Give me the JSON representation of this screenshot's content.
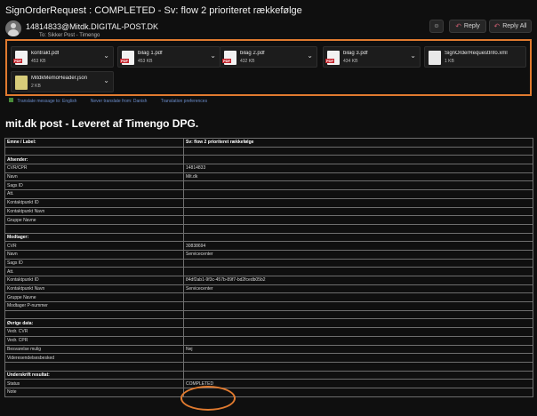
{
  "window": {
    "title": "SignOrderRequest : COMPLETED - Sv: flow 2 prioriteret rækkefølge"
  },
  "header": {
    "sender": "14814833@Mitdk.DIGITAL-POST.DK",
    "to_line": "To: Sikker Post - Timengo",
    "reply_label": "Reply",
    "reply_all_label": "Reply All",
    "emoji_icon": "smiley-icon"
  },
  "attachments": [
    {
      "name": "kontrakt.pdf",
      "size": "453 KB",
      "type": "pdf"
    },
    {
      "name": "bilag 1.pdf",
      "size": "453 KB",
      "type": "pdf"
    },
    {
      "name": "bilag 2.pdf",
      "size": "432 KB",
      "type": "pdf"
    },
    {
      "name": "bilag 3.pdf",
      "size": "434 KB",
      "type": "pdf"
    },
    {
      "name": "SignOrderRequestInfo.xml",
      "size": "1 KB",
      "type": "xml"
    },
    {
      "name": "MitdkMemoHeader.json",
      "size": "2 KB",
      "type": "json"
    }
  ],
  "notice": {
    "link1": "Translate message to: English",
    "link2": "Never translate from: Danish",
    "link3": "Translation preferences"
  },
  "body": {
    "title": "mit.dk post - Leveret af Timengo DPG.",
    "rows": [
      {
        "label": "Emne / Label:",
        "value": "Sv: flow 2 prioriteret rækkefølge",
        "bold": true
      },
      {
        "label": "",
        "value": ""
      },
      {
        "label": "Afsender:",
        "value": "",
        "bold": true
      },
      {
        "label": "CVR/CPR",
        "value": "14814833"
      },
      {
        "label": "Navn",
        "value": "Mit.dk"
      },
      {
        "label": "Sags ID",
        "value": ""
      },
      {
        "label": "Att.",
        "value": ""
      },
      {
        "label": "Kontaktpunkt ID",
        "value": ""
      },
      {
        "label": "Kontaktpunkt Navn",
        "value": ""
      },
      {
        "label": "Gruppe Navne",
        "value": ""
      },
      {
        "label": "",
        "value": ""
      },
      {
        "label": "Modtager:",
        "value": "",
        "bold": true
      },
      {
        "label": "CVR",
        "value": "30838694"
      },
      {
        "label": "Navn",
        "value": "Servicecenter"
      },
      {
        "label": "Sags ID",
        "value": ""
      },
      {
        "label": "Att.",
        "value": ""
      },
      {
        "label": "Kontaktpunkt ID",
        "value": "84df2ab1-9f3c-457b-89f7-bd2fcedb05b2"
      },
      {
        "label": "Kontaktpunkt Navn",
        "value": "Servicecenter"
      },
      {
        "label": "Gruppe Navne",
        "value": ""
      },
      {
        "label": "Modtager P-nummer",
        "value": ""
      },
      {
        "label": "",
        "value": ""
      },
      {
        "label": "Øvrige data:",
        "value": "",
        "bold": true
      },
      {
        "label": "Vedr. CVR",
        "value": ""
      },
      {
        "label": "Vedr. CPR",
        "value": ""
      },
      {
        "label": "Besvarelse mulig",
        "value": "Nej"
      },
      {
        "label": "Videresendelsesbesked",
        "value": ""
      },
      {
        "label": "",
        "value": ""
      },
      {
        "label": "Underskrift resultat:",
        "value": "",
        "bold": true
      },
      {
        "label": "Status",
        "value": "COMPLETED"
      },
      {
        "label": "Note",
        "value": ""
      }
    ]
  },
  "colors": {
    "highlight": "#e07a2f",
    "background": "#0f0f0f",
    "link": "#6b8cc9"
  }
}
